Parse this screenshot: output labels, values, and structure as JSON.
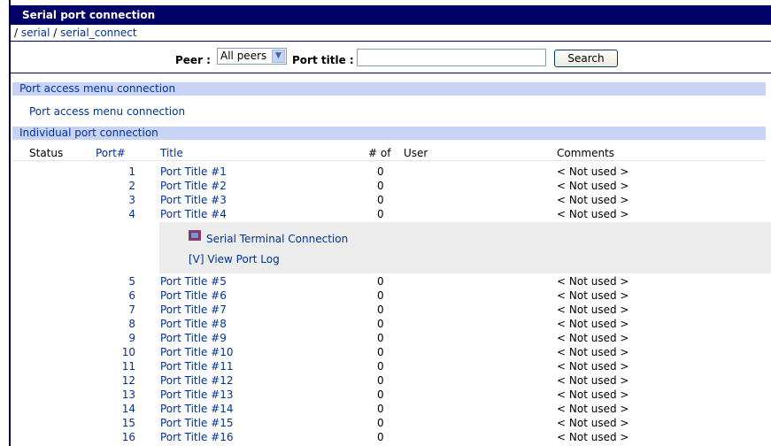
{
  "title": "Serial port connection",
  "breadcrumb": {
    "prefix": "/ ",
    "part1": "serial",
    "sep": " / ",
    "part2": "serial_connect"
  },
  "search": {
    "peer_label": "Peer :",
    "peer_selected": "All peers",
    "port_title_label": "Port title :",
    "port_title_value": "",
    "button": "Search"
  },
  "menu_section": {
    "header": "Port access menu connection",
    "link": "Port access menu connection"
  },
  "individual_section": {
    "header": "Individual port connection",
    "columns": {
      "status": "Status",
      "port": "Port#",
      "title": "Title",
      "count": "# of",
      "user": "User",
      "comments": "Comments"
    }
  },
  "expanded_panel": {
    "terminal_link": "Serial Terminal Connection",
    "log_link": "[V] View Port Log"
  },
  "ports": [
    {
      "port": "1",
      "title": "Port Title #1",
      "count": "0",
      "user": "",
      "comment": "< Not used >"
    },
    {
      "port": "2",
      "title": "Port Title #2",
      "count": "0",
      "user": "",
      "comment": "< Not used >"
    },
    {
      "port": "3",
      "title": "Port Title #3",
      "count": "0",
      "user": "",
      "comment": "< Not used >"
    },
    {
      "port": "4",
      "title": "Port Title #4",
      "count": "0",
      "user": "",
      "comment": "< Not used >"
    },
    {
      "port": "5",
      "title": "Port Title #5",
      "count": "0",
      "user": "",
      "comment": "< Not used >"
    },
    {
      "port": "6",
      "title": "Port Title #6",
      "count": "0",
      "user": "",
      "comment": "< Not used >"
    },
    {
      "port": "7",
      "title": "Port Title #7",
      "count": "0",
      "user": "",
      "comment": "< Not used >"
    },
    {
      "port": "8",
      "title": "Port Title #8",
      "count": "0",
      "user": "",
      "comment": "< Not used >"
    },
    {
      "port": "9",
      "title": "Port Title #9",
      "count": "0",
      "user": "",
      "comment": "< Not used >"
    },
    {
      "port": "10",
      "title": "Port Title #10",
      "count": "0",
      "user": "",
      "comment": "< Not used >"
    },
    {
      "port": "11",
      "title": "Port Title #11",
      "count": "0",
      "user": "",
      "comment": "< Not used >"
    },
    {
      "port": "12",
      "title": "Port Title #12",
      "count": "0",
      "user": "",
      "comment": "< Not used >"
    },
    {
      "port": "13",
      "title": "Port Title #13",
      "count": "0",
      "user": "",
      "comment": "< Not used >"
    },
    {
      "port": "14",
      "title": "Port Title #14",
      "count": "0",
      "user": "",
      "comment": "< Not used >"
    },
    {
      "port": "15",
      "title": "Port Title #15",
      "count": "0",
      "user": "",
      "comment": "< Not used >"
    },
    {
      "port": "16",
      "title": "Port Title #16",
      "count": "0",
      "user": "",
      "comment": "< Not used >"
    }
  ],
  "colors": {
    "titlebar": "#000066",
    "section_bg": "#c8d3f5",
    "link": "#003399",
    "panel_bg": "#ececec"
  },
  "icons": {
    "terminal": "terminal-icon",
    "dropdown": "chevron-down-icon"
  }
}
